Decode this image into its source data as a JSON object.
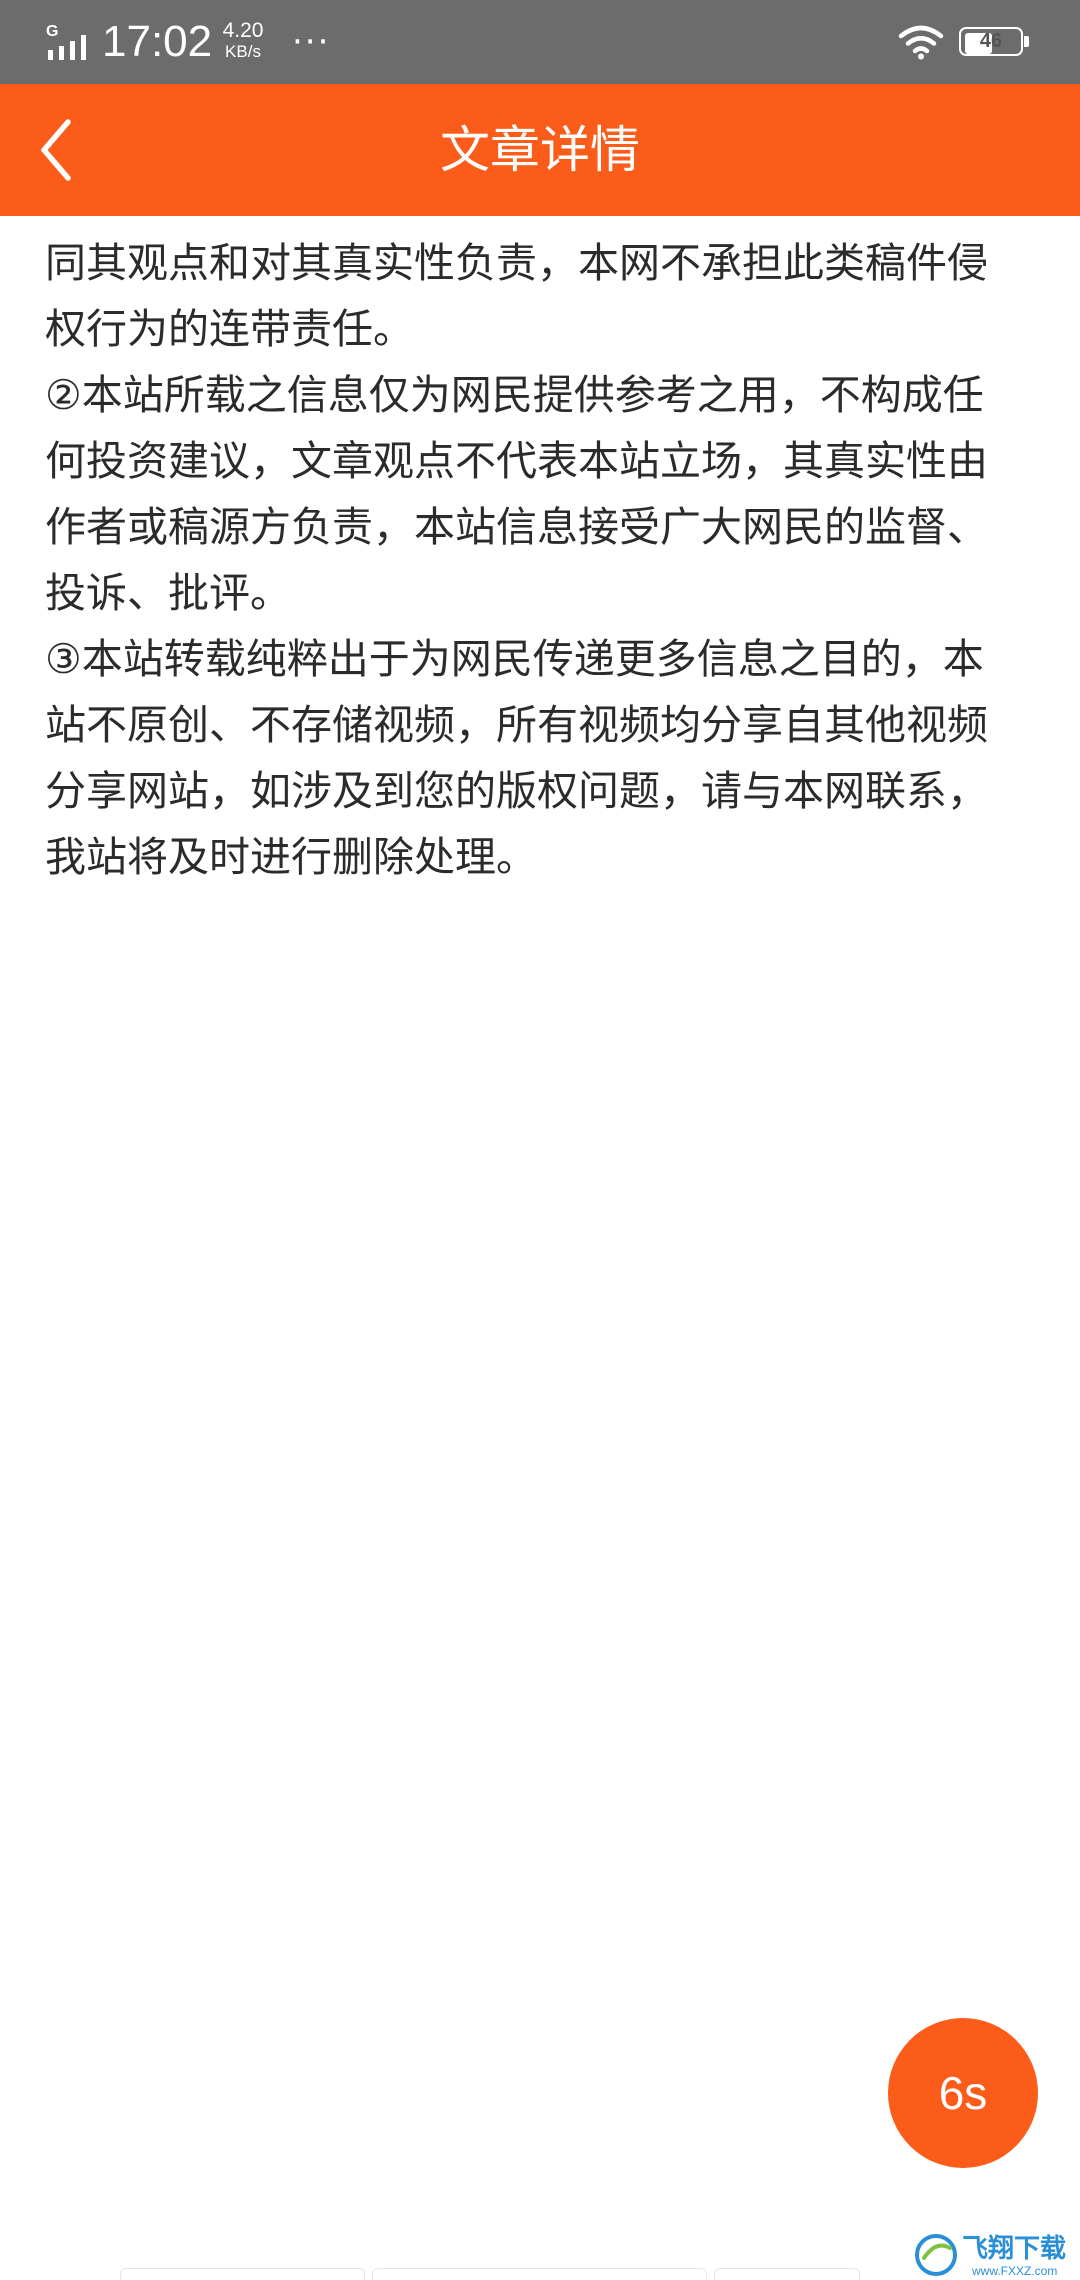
{
  "status_bar": {
    "network_label": "G",
    "time": "17:02",
    "net_speed_value": "4.20",
    "net_speed_unit": "KB/s",
    "more_icon": "···",
    "battery_level": "46",
    "icons": [
      "signal-icon",
      "wifi-icon",
      "battery-icon"
    ]
  },
  "header": {
    "title": "文章详情",
    "background_color": "#fb5c1a",
    "back_icon": "chevron-left-icon"
  },
  "article": {
    "lines": [
      "同其观点和对其真实性负责，本网不承担此类稿件侵",
      "权行为的连带责任。",
      "②本站所载之信息仅为网民提供参考之用，不构成任",
      "何投资建议，文章观点不代表本站立场，其真实性由",
      "作者或稿源方负责，本站信息接受广大网民的监督、",
      "投诉、批评。",
      "③本站转载纯粹出于为网民传递更多信息之目的，本",
      "站不原创、不存储视频，所有视频均分享自其他视频",
      "分享网站，如涉及到您的版权问题，请与本网联系，",
      "我站将及时进行删除处理。"
    ]
  },
  "countdown": {
    "label": "6s",
    "color": "#fb5c1a"
  },
  "watermark": {
    "text": "飞翔下载",
    "subtext": "www.FXXZ.com"
  }
}
